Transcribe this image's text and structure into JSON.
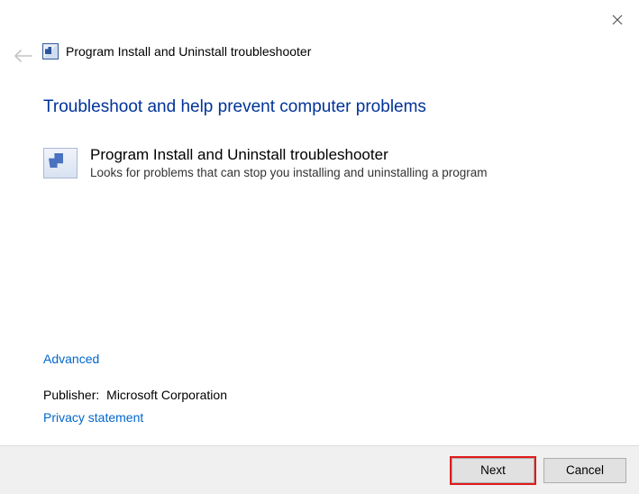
{
  "window": {
    "title": "Program Install and Uninstall troubleshooter"
  },
  "heading": "Troubleshoot and help prevent computer problems",
  "troubleshooter": {
    "name": "Program Install and Uninstall troubleshooter",
    "description": "Looks for problems that can stop you installing and uninstalling a program"
  },
  "links": {
    "advanced": "Advanced",
    "privacy": "Privacy statement"
  },
  "publisher": {
    "label": "Publisher:",
    "value": "Microsoft Corporation"
  },
  "buttons": {
    "next": "Next",
    "cancel": "Cancel"
  }
}
